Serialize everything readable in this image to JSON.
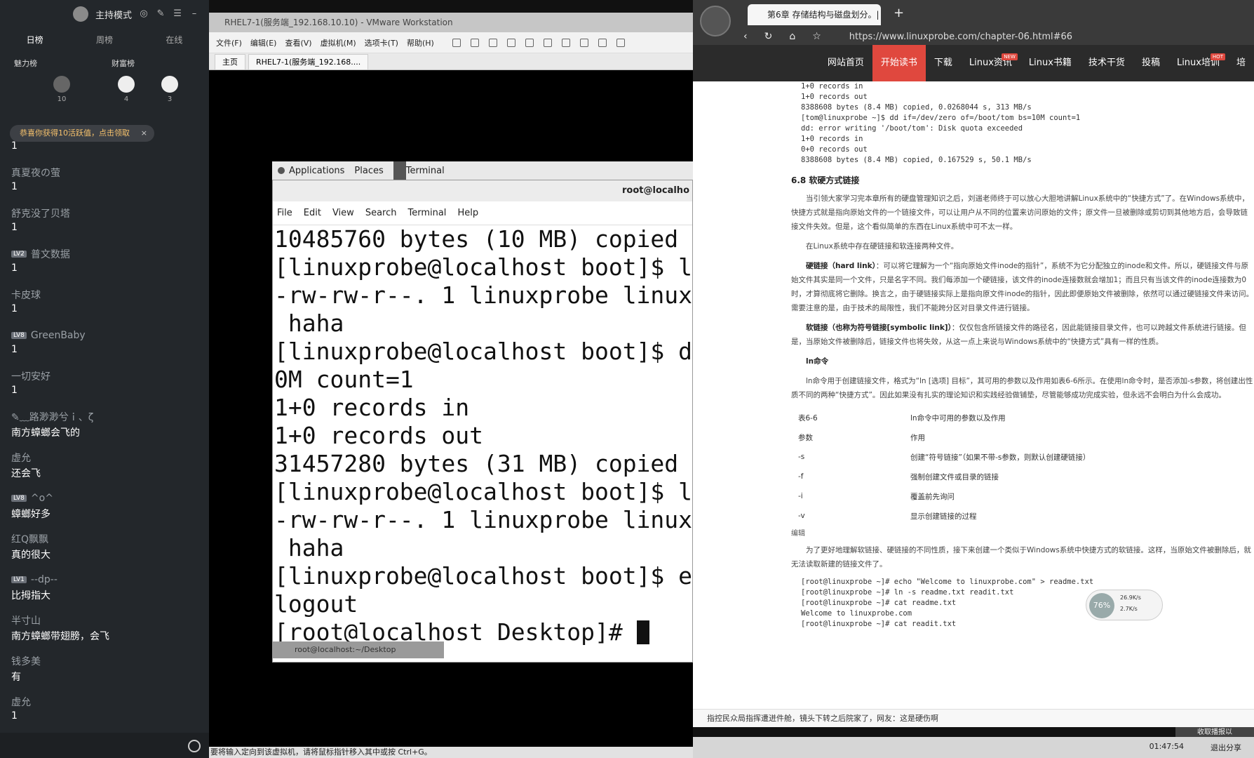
{
  "chat": {
    "mode_label": "主持模式",
    "tabs": [
      "日榜",
      "周榜",
      "在线"
    ],
    "rank_headers": [
      "魅力榜",
      "财富榜"
    ],
    "rank_counts": [
      "10",
      "4",
      "3"
    ],
    "notice": "恭喜你获得10活跃值，点击领取",
    "messages": [
      {
        "user": "",
        "level": "",
        "text": "1"
      },
      {
        "user": "真夏夜の萤",
        "level": "",
        "text": "1"
      },
      {
        "user": "舒克没了贝塔",
        "level": "",
        "text": "1"
      },
      {
        "user": "普文数据",
        "level": "LV2",
        "text": "1"
      },
      {
        "user": "卡皮球",
        "level": "",
        "text": "1"
      },
      {
        "user": "GreenBaby",
        "level": "LV8",
        "text": "1"
      },
      {
        "user": "一切安好",
        "level": "",
        "text": "1"
      },
      {
        "user": "✎﹏路渺渺兮ｉ、ζ",
        "level": "",
        "text": "南方蟑螂会飞的"
      },
      {
        "user": "虚允",
        "level": "",
        "text": "还会飞"
      },
      {
        "user": "^o^",
        "level": "LV8",
        "text": "蟑螂好多"
      },
      {
        "user": "红Q飘飘",
        "level": "",
        "text": "真的很大"
      },
      {
        "user": "--dp--",
        "level": "LV1",
        "text": "比拇指大"
      },
      {
        "user": "半寸山",
        "level": "",
        "text": "南方蟑螂带翅膀，会飞"
      },
      {
        "user": "钱多美",
        "level": "",
        "text": "有"
      },
      {
        "user": "虚允",
        "level": "",
        "text": "1"
      }
    ]
  },
  "vmware": {
    "title": "RHEL7-1(服务端_192.168.10.10) - VMware Workstation",
    "menu": [
      "文件(F)",
      "编辑(E)",
      "查看(V)",
      "虚拟机(M)",
      "选项卡(T)",
      "帮助(H)"
    ],
    "tabs": [
      "主页",
      "RHEL7-1(服务端_192.168...."
    ],
    "status": "要将输入定向到该虚拟机，请将鼠标指针移入其中或按 Ctrl+G。"
  },
  "gnome": {
    "applications": "Applications",
    "places": "Places",
    "terminal": "Terminal",
    "task": "root@localhost:~/Desktop"
  },
  "terminal": {
    "title": "root@localho",
    "menu": [
      "File",
      "Edit",
      "View",
      "Search",
      "Terminal",
      "Help"
    ],
    "lines": [
      "10485760 bytes (10 MB) copied",
      "[linuxprobe@localhost boot]$ l",
      "-rw-rw-r--. 1 linuxprobe linux",
      " haha",
      "[linuxprobe@localhost boot]$ d",
      "0M count=1",
      "1+0 records in",
      "1+0 records out",
      "31457280 bytes (31 MB) copied",
      "[linuxprobe@localhost boot]$ l",
      "-rw-rw-r--. 1 linuxprobe linux",
      " haha",
      "[linuxprobe@localhost boot]$ e",
      "logout",
      "[root@localhost Desktop]# "
    ]
  },
  "browser": {
    "tab_title": "第6章 存储结构与磁盘划分。|",
    "url": "https://www.linuxprobe.com/chapter-06.html#66",
    "nav": [
      {
        "label": "网站首页",
        "badge": ""
      },
      {
        "label": "开始读书",
        "badge": ""
      },
      {
        "label": "下载",
        "badge": ""
      },
      {
        "label": "Linux资讯",
        "badge": "NEW"
      },
      {
        "label": "Linux书籍",
        "badge": ""
      },
      {
        "label": "技术干货",
        "badge": ""
      },
      {
        "label": "投稿",
        "badge": ""
      },
      {
        "label": "Linux培训",
        "badge": "HOT"
      },
      {
        "label": "培",
        "badge": ""
      }
    ],
    "code_top": "1+0 records in\n1+0 records out\n8388608 bytes (8.4 MB) copied, 0.0268044 s, 313 MB/s\n[tom@linuxprobe ~]$ dd if=/dev/zero of=/boot/tom bs=10M count=1\ndd: error writing '/boot/tom': Disk quota exceeded\n1+0 records in\n0+0 records out\n8388608 bytes (8.4 MB) copied, 0.167529 s, 50.1 MB/s",
    "section_title": "6.8 软硬方式链接",
    "p1": "当引领大家学习完本章所有的硬盘管理知识之后，刘遄老师终于可以放心大胆地讲解Linux系统中的“快捷方式”了。在Windows系统中，快捷方式就是指向原始文件的一个链接文件，可以让用户从不同的位置来访问原始的文件；原文件一旦被删除或剪切到其他地方后，会导致链接文件失效。但是，这个看似简单的东西在Linux系统中可不太一样。",
    "p2": "在Linux系统中存在硬链接和软连接两种文件。",
    "p3_bold": "硬链接（hard link）",
    "p3": "：可以将它理解为一个“指向原始文件inode的指针”，系统不为它分配独立的inode和文件。所以，硬链接文件与原始文件其实是同一个文件，只是名字不同。我们每添加一个硬链接，该文件的inode连接数就会增加1；而且只有当该文件的inode连接数为0时，才算彻底将它删除。换言之，由于硬链接实际上是指向原文件inode的指针，因此即便原始文件被删除，依然可以通过硬链接文件来访问。需要注意的是，由于技术的局限性，我们不能跨分区对目录文件进行链接。",
    "p4_bold": "软链接（也称为符号链接[symbolic link]）",
    "p4": "：仅仅包含所链接文件的路径名，因此能链接目录文件，也可以跨越文件系统进行链接。但是，当原始文件被删除后，链接文件也将失效，从这一点上来说与Windows系统中的“快捷方式”具有一样的性质。",
    "ln_title": "ln命令",
    "p5": "ln命令用于创建链接文件，格式为“ln [选项] 目标”，其可用的参数以及作用如表6-6所示。在使用ln命令时，是否添加-s参数，将创建出性质不同的两种“快捷方式”。因此如果没有扎实的理论知识和实践经验做铺垫，尽管能够成功完成实验，但永远不会明白为什么会成功。",
    "table_caption": "表6-6",
    "table_title": "ln命令中可用的参数以及作用",
    "table_head": [
      "参数",
      "作用"
    ],
    "table_rows": [
      [
        "-s",
        "创建“符号链接”（如果不带-s参数，则默认创建硬链接）"
      ],
      [
        "-f",
        "强制创建文件或目录的链接"
      ],
      [
        "-i",
        "覆盖前先询问"
      ],
      [
        "-v",
        "显示创建链接的过程"
      ]
    ],
    "edit_label": "编辑",
    "p6": "为了更好地理解软链接、硬链接的不同性质，接下来创建一个类似于Windows系统中快捷方式的软链接。这样，当原始文件被删除后，就无法读取新建的链接文件了。",
    "code_bottom": "[root@linuxprobe ~]# echo \"Welcome to linuxprobe.com\" > readme.txt\n[root@linuxprobe ~]# ln -s readme.txt readit.txt\n[root@linuxprobe ~]# cat readme.txt\nWelcome to linuxprobe.com\n[root@linuxprobe ~]# cat readit.txt",
    "speed_pct": "76%",
    "speed_up": "26.9K/s",
    "speed_down": "2.7K/s",
    "ticker": "指控民众局指挥遭迸件舱，镜头下转之后院家了，网友：这是硬伤啊"
  },
  "systray": {
    "time": "01:47:54",
    "exit": "退出分享",
    "banner": "收取播报以"
  }
}
